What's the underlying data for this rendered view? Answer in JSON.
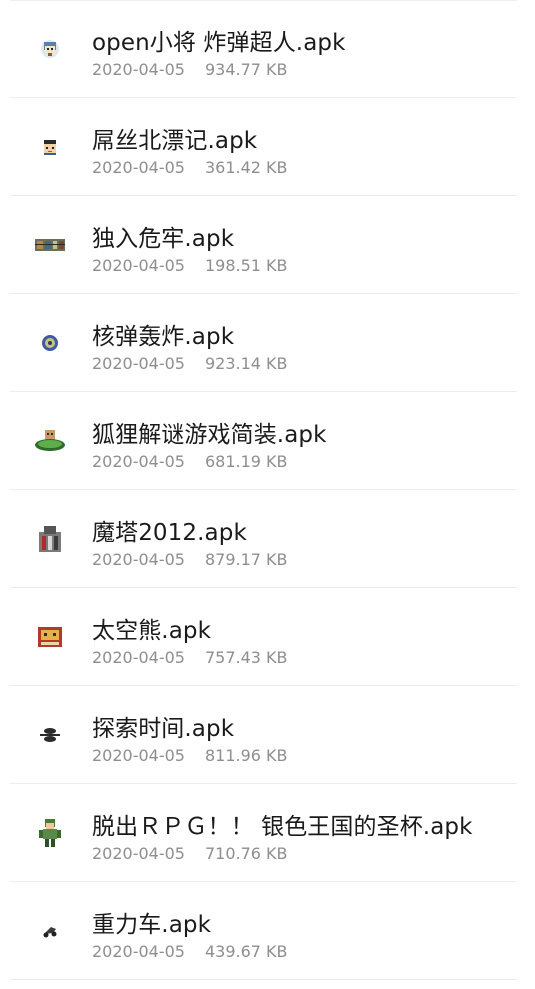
{
  "files": [
    {
      "name": "open小将 炸弹超人.apk",
      "date": "2020-04-05",
      "size": "934.77 KB",
      "icon": "bomberman-icon"
    },
    {
      "name": "屌丝北漂记.apk",
      "date": "2020-04-05",
      "size": "361.42 KB",
      "icon": "pixel-face-icon"
    },
    {
      "name": "独入危牢.apk",
      "date": "2020-04-05",
      "size": "198.51 KB",
      "icon": "prison-escape-icon"
    },
    {
      "name": "核弹轰炸.apk",
      "date": "2020-04-05",
      "size": "923.14 KB",
      "icon": "nuke-globe-icon"
    },
    {
      "name": "狐狸解谜游戏简装.apk",
      "date": "2020-04-05",
      "size": "681.19 KB",
      "icon": "fox-puzzle-icon"
    },
    {
      "name": "魔塔2012.apk",
      "date": "2020-04-05",
      "size": "879.17 KB",
      "icon": "magic-tower-icon"
    },
    {
      "name": "太空熊.apk",
      "date": "2020-04-05",
      "size": "757.43 KB",
      "icon": "space-bear-icon"
    },
    {
      "name": "探索时间.apk",
      "date": "2020-04-05",
      "size": "811.96 KB",
      "icon": "ufo-icon"
    },
    {
      "name": "脱出ＲＰＧ！！ 银色王国的圣杯.apk",
      "date": "2020-04-05",
      "size": "710.76 KB",
      "icon": "rpg-soldier-icon"
    },
    {
      "name": "重力车.apk",
      "date": "2020-04-05",
      "size": "439.67 KB",
      "icon": "gravity-car-icon"
    }
  ]
}
